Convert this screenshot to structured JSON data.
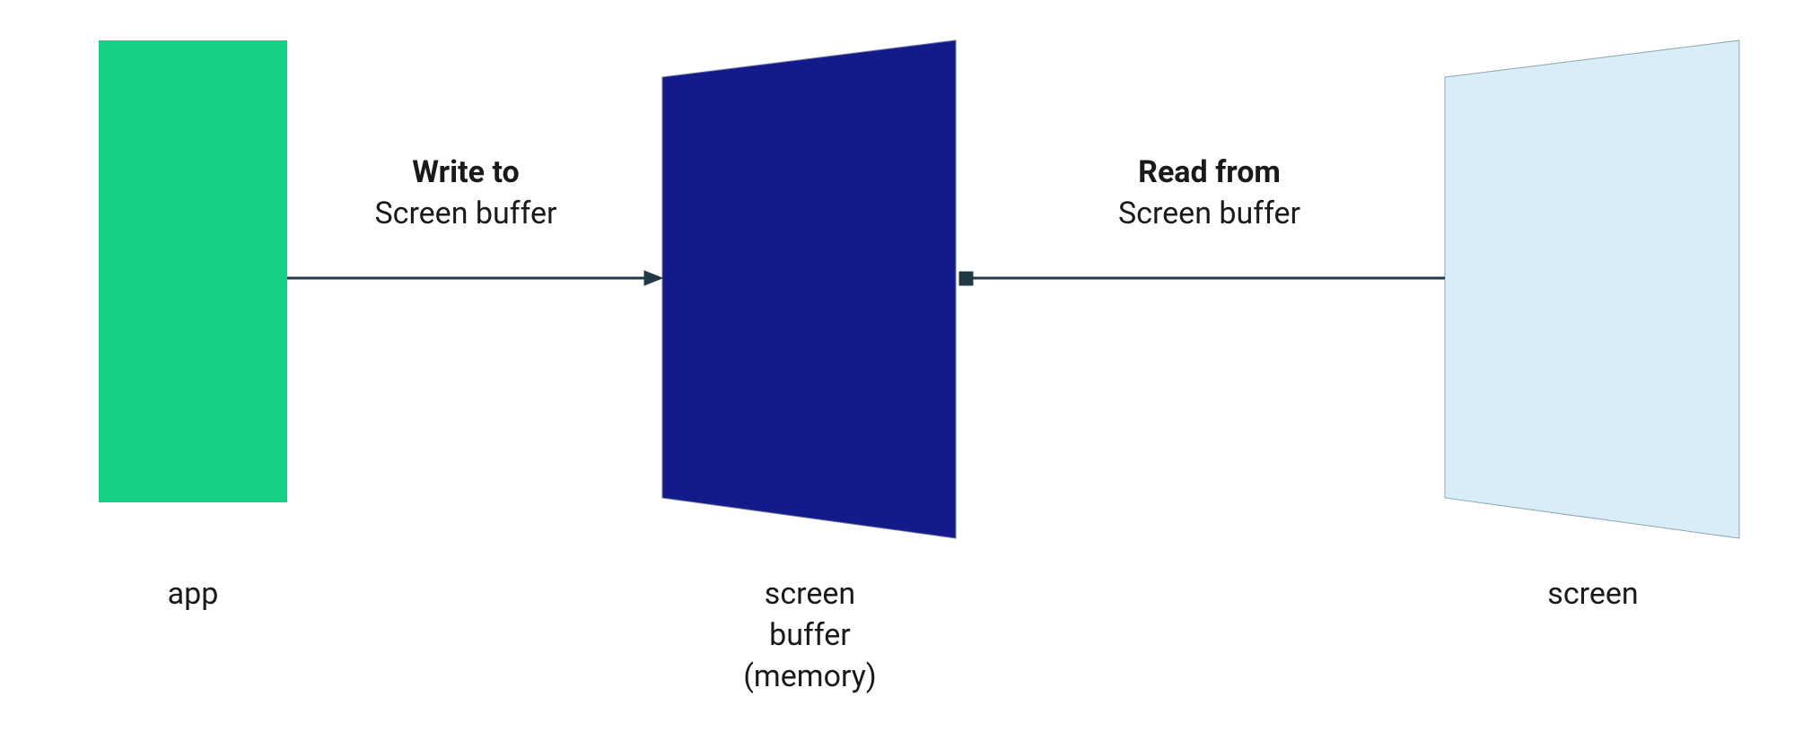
{
  "nodes": {
    "app": {
      "label": "app"
    },
    "buffer": {
      "label_line1": "screen",
      "label_line2": "buffer",
      "label_line3": "(memory)"
    },
    "screen": {
      "label": "screen"
    }
  },
  "arrows": {
    "write": {
      "bold": "Write to",
      "plain": "Screen buffer"
    },
    "read": {
      "bold": "Read from",
      "plain": "Screen buffer"
    }
  },
  "colors": {
    "app": "#14d184",
    "buffer_fill": "#131b8a",
    "buffer_stroke": "#6a6fa0",
    "screen_fill": "#d8edf6",
    "screen_stroke": "#8aa6b5",
    "arrow": "#1f3a44"
  }
}
